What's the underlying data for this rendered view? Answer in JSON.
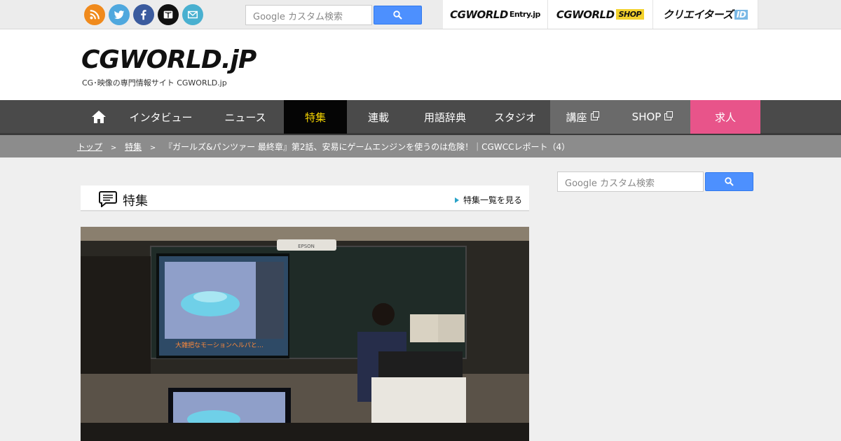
{
  "social_icons": [
    "rss-icon",
    "twitter-icon",
    "facebook-icon",
    "book-icon",
    "mail-icon"
  ],
  "search": {
    "placeholder": "Google カスタム検索"
  },
  "sister_sites": [
    {
      "main": "CGWORLD",
      "suffix": "Entry.jp"
    },
    {
      "main": "CGWORLD",
      "suffix": "SHOP"
    },
    {
      "main": "クリエイターズ",
      "suffix": "ID"
    }
  ],
  "header": {
    "logo": "CGWORLD.jP",
    "tagline": "CG･映像の専門情報サイト CGWORLD.jp"
  },
  "nav": {
    "items": [
      "インタビュー",
      "ニュース",
      "特集",
      "連載",
      "用語辞典",
      "スタジオ",
      "講座",
      "SHOP",
      "求人"
    ]
  },
  "breadcrumb": {
    "top": "トップ",
    "section": "特集",
    "current": "『ガールズ&パンツァー 最終章』第2話、安易にゲームエンジンを使うのは危険！｜CGWCCレポート（4）",
    "sep": ">"
  },
  "feature": {
    "title": "特集",
    "more_link": "特集一覧を見る"
  },
  "photo": {
    "projector_brand": "EPSON",
    "slide_caption": "大雑把なモーションヘルパと…"
  },
  "colors": {
    "nav_bg": "#4a4a4a",
    "nav_active_bg": "#050505",
    "nav_active_text": "#f2d200",
    "job_bg": "#e8548a",
    "google_blue": "#4d90fe"
  }
}
